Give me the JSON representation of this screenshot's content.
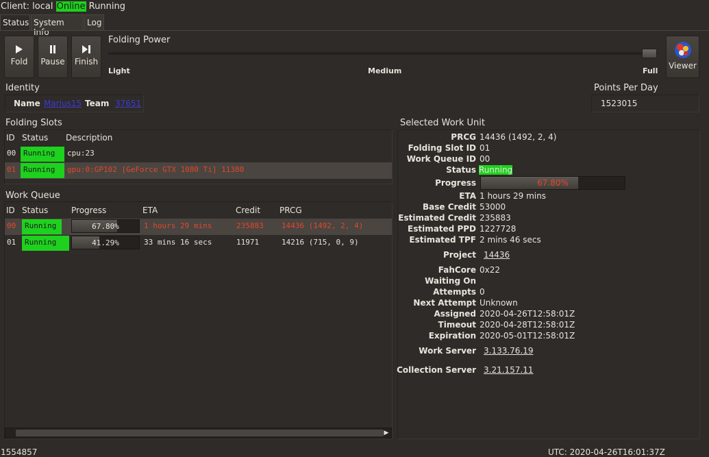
{
  "top": {
    "client_label": "Client: local",
    "online": "Online",
    "running": "Running"
  },
  "tabs": [
    "Status",
    "System Info",
    "Log"
  ],
  "controls": {
    "fold": "Fold",
    "pause": "Pause",
    "finish": "Finish",
    "viewer": "Viewer"
  },
  "folding_power": {
    "title": "Folding Power",
    "light": "Light",
    "medium": "Medium",
    "full": "Full",
    "level": 1.0
  },
  "identity": {
    "title": "Identity",
    "name_label": "Name",
    "name_value": "Marius15",
    "team_label": "Team",
    "team_value": "37651"
  },
  "ppd": {
    "title": "Points Per Day",
    "value": "1523015"
  },
  "folding_slots": {
    "title": "Folding Slots",
    "headers": [
      "ID",
      "Status",
      "Description"
    ],
    "rows": [
      {
        "id": "00",
        "status": "Running",
        "description": "cpu:23"
      },
      {
        "id": "01",
        "status": "Running",
        "description": "gpu:0:GP102 [GeForce GTX 1080 Ti] 11380"
      }
    ]
  },
  "work_queue": {
    "title": "Work Queue",
    "headers": [
      "ID",
      "Status",
      "Progress",
      "ETA",
      "Credit",
      "PRCG"
    ],
    "rows": [
      {
        "id": "00",
        "status": "Running",
        "progress": "67.80%",
        "progress_value": 0.678,
        "eta": "1 hours 29 mins",
        "credit": "235883",
        "prcg": "14436 (1492, 2, 4)"
      },
      {
        "id": "01",
        "status": "Running",
        "progress": "41.29%",
        "progress_value": 0.4129,
        "eta": "33 mins 16 secs",
        "credit": "11971",
        "prcg": "14216 (715, 0, 9)"
      }
    ]
  },
  "selected_wu": {
    "title": "Selected Work Unit",
    "prcg_label": "PRCG",
    "prcg": "14436 (1492, 2, 4)",
    "slot_label": "Folding Slot ID",
    "slot": "01",
    "queue_label": "Work Queue ID",
    "queue": "00",
    "status_label": "Status",
    "status": "Running",
    "progress_label": "Progress",
    "progress": "67.80%",
    "progress_value": 0.678,
    "eta_label": "ETA",
    "eta": "1 hours 29 mins",
    "base_credit_label": "Base Credit",
    "base_credit": "53000",
    "est_credit_label": "Estimated Credit",
    "est_credit": "235883",
    "est_ppd_label": "Estimated PPD",
    "est_ppd": "1227728",
    "est_tpf_label": "Estimated TPF",
    "est_tpf": "2 mins 46 secs",
    "project_label": "Project",
    "project": "14436",
    "fahcore_label": "FahCore",
    "fahcore": "0x22",
    "waiting_label": "Waiting On",
    "waiting": "",
    "attempts_label": "Attempts",
    "attempts": "0",
    "next_attempt_label": "Next Attempt",
    "next_attempt": "Unknown",
    "assigned_label": "Assigned",
    "assigned": "2020-04-26T12:58:01Z",
    "timeout_label": "Timeout",
    "timeout": "2020-04-28T12:58:01Z",
    "expiration_label": "Expiration",
    "expiration": "2020-05-01T12:58:01Z",
    "work_server_label": "Work Server",
    "work_server": "3.133.76.19",
    "collection_server_label": "Collection Server",
    "collection_server": "3.21.157.11"
  },
  "statusbar": {
    "left": "1554857",
    "right": "UTC: 2020-04-26T16:01:37Z"
  },
  "colors": {
    "running_green": "#1ed11e",
    "selected_text": "#e0482a",
    "link": "#3b3bd8"
  }
}
